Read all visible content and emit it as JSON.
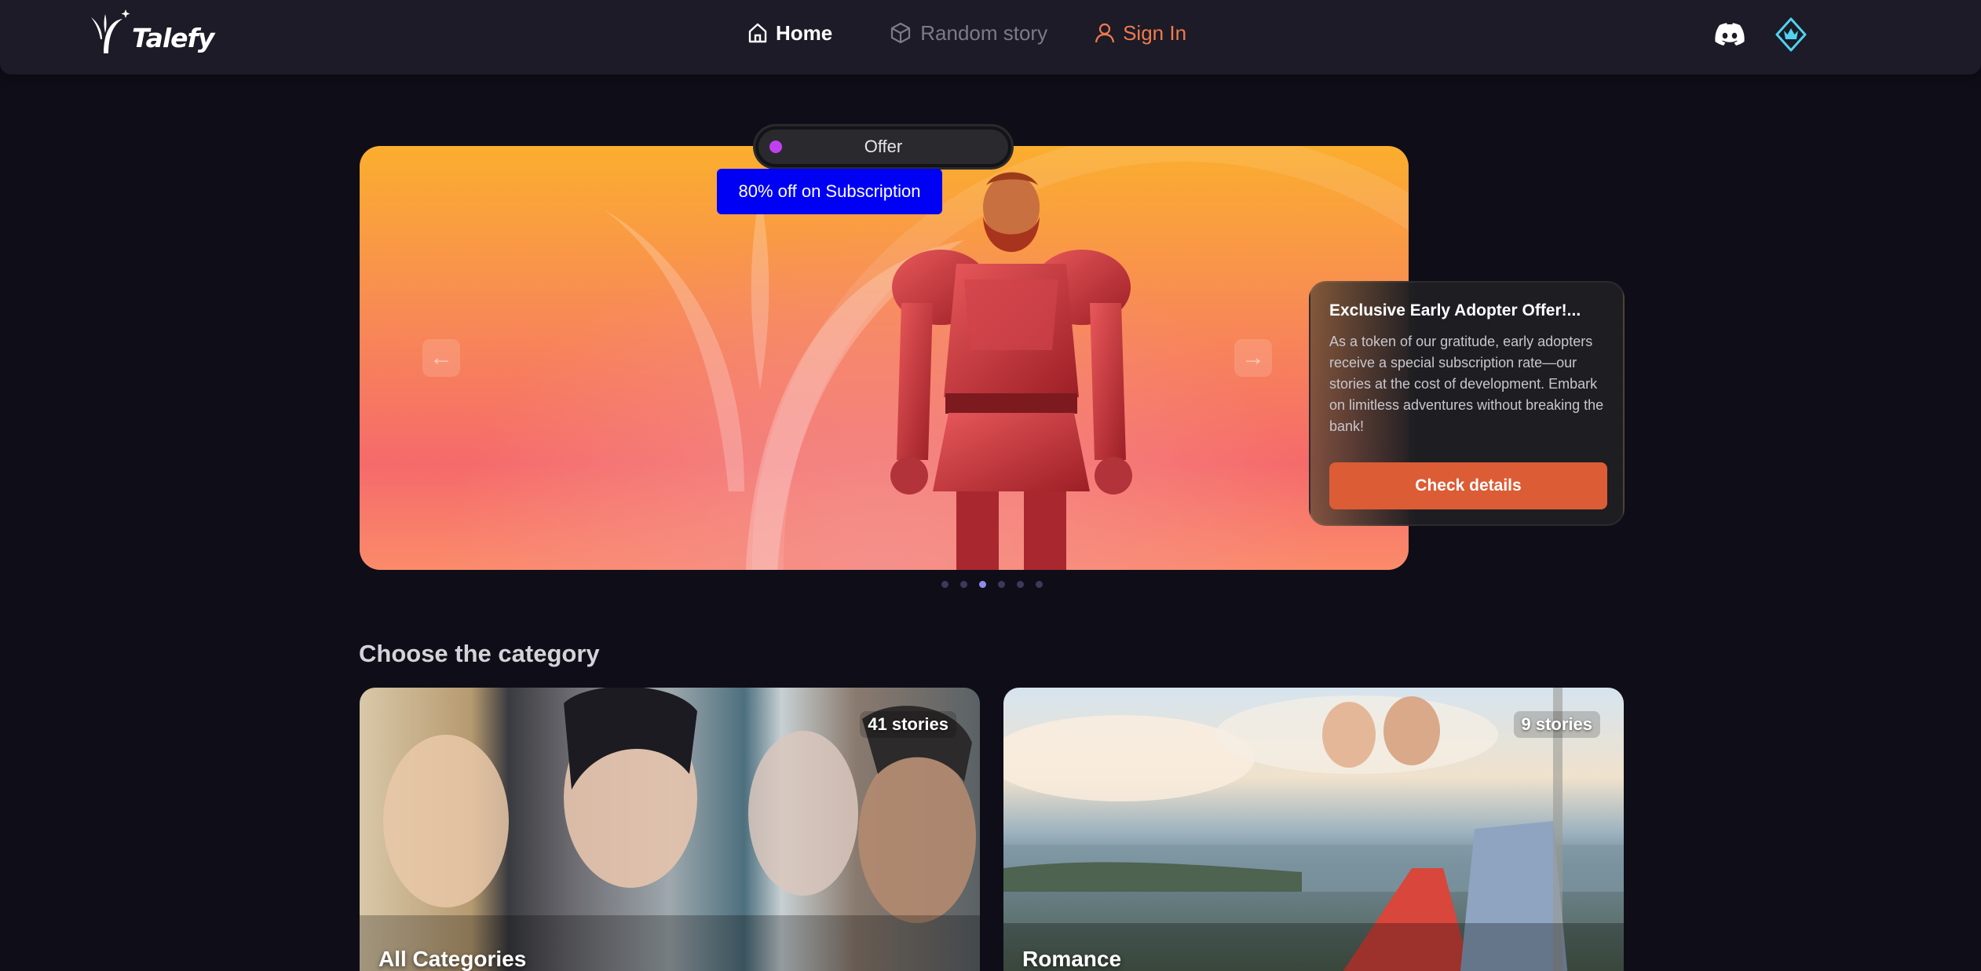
{
  "app": {
    "brand": "Talefy"
  },
  "nav": {
    "home": "Home",
    "random": "Random story",
    "signin": "Sign In"
  },
  "top_icons": {
    "discord": "discord-icon",
    "premium": "crown-icon"
  },
  "banner": {
    "offer_label": "Offer",
    "badge": "80% off on Subscription",
    "card_title": "Exclusive Early Adopter Offer!...",
    "card_text": "As a token of our gratitude, early adopters receive a special subscription rate—our stories at the cost of development. Embark on limitless adventures without breaking the bank!",
    "cta": "Check details",
    "slide_count": 6,
    "active_slide": 3
  },
  "categories": {
    "title": "Choose the category",
    "items": [
      {
        "name": "All Categories",
        "count": "41 stories"
      },
      {
        "name": "Romance",
        "count": "9 stories"
      }
    ]
  },
  "colors": {
    "accent": "#dc5c35",
    "signin": "#f07a4e",
    "badge": "#0000f5",
    "background": "#0f0e18"
  }
}
